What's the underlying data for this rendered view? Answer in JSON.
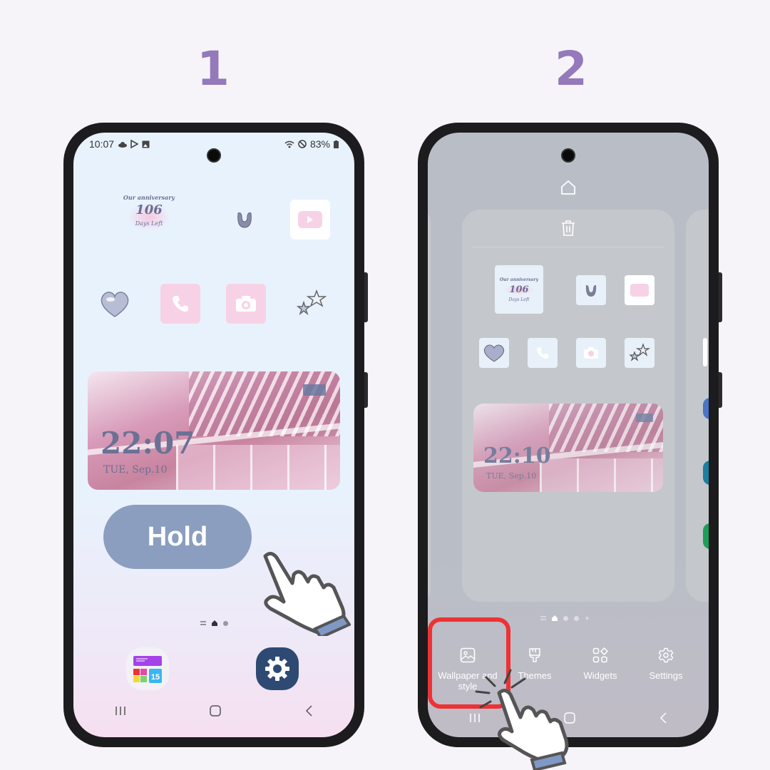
{
  "steps": [
    "1",
    "2"
  ],
  "phone1": {
    "status_bar": {
      "time": "10:07",
      "left_icons": [
        "cloud-icon",
        "play-store-icon",
        "gallery-icon"
      ],
      "right_icons": [
        "wifi-icon",
        "do-not-disturb-icon"
      ],
      "battery": "83%"
    },
    "anniversary_widget": {
      "title": "Our anniversary",
      "days": "106",
      "subtitle": "Days Left"
    },
    "apps_row1": [
      "u-icon",
      "youtube-icon"
    ],
    "apps_row2": [
      "heart-icon",
      "phone-icon",
      "camera-icon",
      "stars-icon"
    ],
    "clock_widget": {
      "time": "22:07",
      "date": "TUE, Sep.10"
    },
    "hold_label": "Hold",
    "dock": [
      "calendar-app-icon",
      "settings-icon"
    ],
    "nav": [
      "recents",
      "home",
      "back"
    ]
  },
  "phone2": {
    "anniversary_widget": {
      "title": "Our anniversary",
      "days": "106",
      "subtitle": "Days Left"
    },
    "clock_widget": {
      "time": "22:10",
      "date": "TUE, Sep.10"
    },
    "options": [
      {
        "icon": "image-icon",
        "label": "Wallpaper and style"
      },
      {
        "icon": "brush-icon",
        "label": "Themes"
      },
      {
        "icon": "widgets-icon",
        "label": "Widgets"
      },
      {
        "icon": "gear-icon",
        "label": "Settings"
      }
    ],
    "highlight_color": "#ee3234"
  },
  "colors": {
    "step": "#9479bb",
    "hold": "#8b9ec0"
  }
}
